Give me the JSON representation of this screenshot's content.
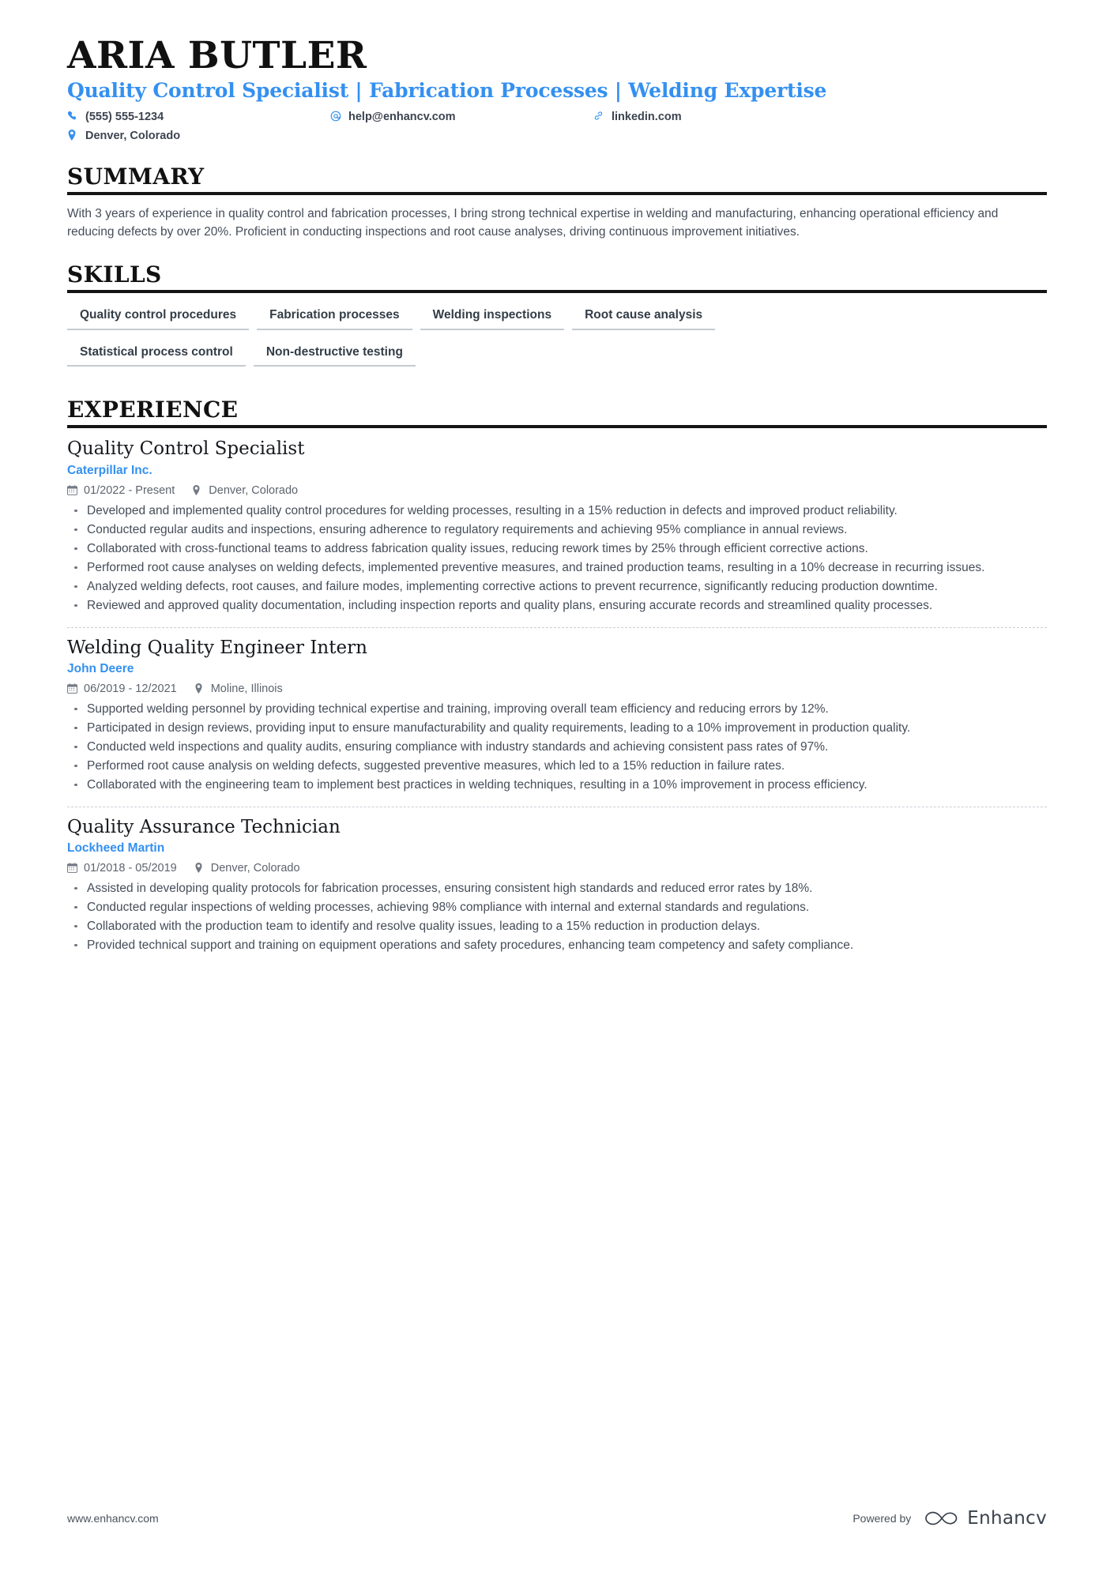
{
  "header": {
    "name": "ARIA BUTLER",
    "headline": "Quality Control Specialist | Fabrication Processes | Welding Expertise",
    "contacts": [
      {
        "icon": "phone-icon",
        "text": "(555) 555-1234"
      },
      {
        "icon": "email-icon",
        "text": "help@enhancv.com"
      },
      {
        "icon": "link-icon",
        "text": "linkedin.com"
      },
      {
        "icon": "location-icon",
        "text": "Denver, Colorado"
      }
    ]
  },
  "summary": {
    "title": "SUMMARY",
    "text": "With 3 years of experience in quality control and fabrication processes, I bring strong technical expertise in welding and manufacturing, enhancing operational efficiency and reducing defects by over 20%. Proficient in conducting inspections and root cause analyses, driving continuous improvement initiatives."
  },
  "skills": {
    "title": "SKILLS",
    "items": [
      "Quality control procedures",
      "Fabrication processes",
      "Welding inspections",
      "Root cause analysis",
      "Statistical process control",
      "Non-destructive testing"
    ]
  },
  "experience": {
    "title": "EXPERIENCE",
    "jobs": [
      {
        "title": "Quality Control Specialist",
        "company": "Caterpillar Inc.",
        "dates": "01/2022 - Present",
        "location": "Denver, Colorado",
        "bullets": [
          "Developed and implemented quality control procedures for welding processes, resulting in a 15% reduction in defects and improved product reliability.",
          "Conducted regular audits and inspections, ensuring adherence to regulatory requirements and achieving 95% compliance in annual reviews.",
          "Collaborated with cross-functional teams to address fabrication quality issues, reducing rework times by 25% through efficient corrective actions.",
          "Performed root cause analyses on welding defects, implemented preventive measures, and trained production teams, resulting in a 10% decrease in recurring issues.",
          "Analyzed welding defects, root causes, and failure modes, implementing corrective actions to prevent recurrence, significantly reducing production downtime.",
          "Reviewed and approved quality documentation, including inspection reports and quality plans, ensuring accurate records and streamlined quality processes."
        ]
      },
      {
        "title": "Welding Quality Engineer Intern",
        "company": "John Deere",
        "dates": "06/2019 - 12/2021",
        "location": "Moline, Illinois",
        "bullets": [
          "Supported welding personnel by providing technical expertise and training, improving overall team efficiency and reducing errors by 12%.",
          "Participated in design reviews, providing input to ensure manufacturability and quality requirements, leading to a 10% improvement in production quality.",
          "Conducted weld inspections and quality audits, ensuring compliance with industry standards and achieving consistent pass rates of 97%.",
          "Performed root cause analysis on welding defects, suggested preventive measures, which led to a 15% reduction in failure rates.",
          "Collaborated with the engineering team to implement best practices in welding techniques, resulting in a 10% improvement in process efficiency."
        ]
      },
      {
        "title": "Quality Assurance Technician",
        "company": "Lockheed Martin",
        "dates": "01/2018 - 05/2019",
        "location": "Denver, Colorado",
        "bullets": [
          "Assisted in developing quality protocols for fabrication processes, ensuring consistent high standards and reduced error rates by 18%.",
          "Conducted regular inspections of welding processes, achieving 98% compliance with internal and external standards and regulations.",
          "Collaborated with the production team to identify and resolve quality issues, leading to a 15% reduction in production delays.",
          "Provided technical support and training on equipment operations and safety procedures, enhancing team competency and safety compliance."
        ]
      }
    ]
  },
  "footer": {
    "url": "www.enhancv.com",
    "powered_by": "Powered by",
    "brand": "Enhancv"
  },
  "colors": {
    "accent": "#3490f0",
    "rule": "#141414",
    "body_text": "#454d59"
  }
}
